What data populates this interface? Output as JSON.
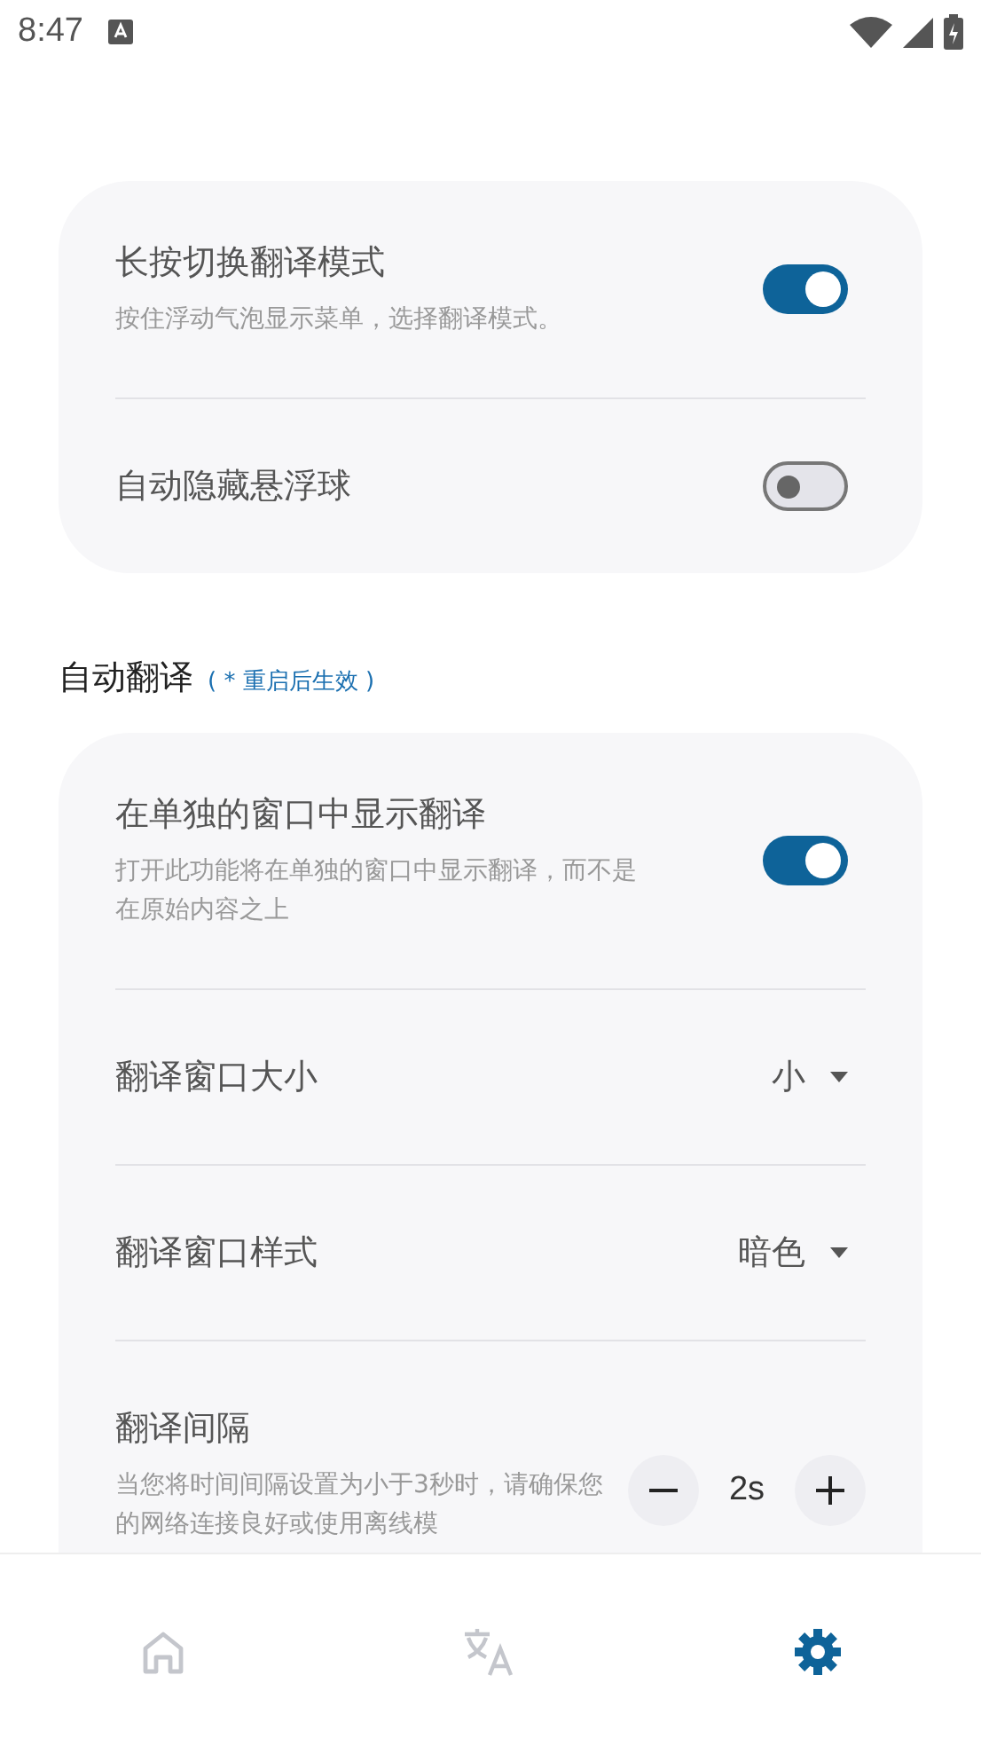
{
  "status_bar": {
    "time": "8:47"
  },
  "general_card": {
    "rows": [
      {
        "kind": "toggle",
        "title": "长按切换翻译模式",
        "description": "按住浮动气泡显示菜单，选择翻译模式。",
        "on": true
      },
      {
        "kind": "toggle",
        "title": "自动隐藏悬浮球",
        "on": false
      }
    ]
  },
  "auto_translate": {
    "title": "自动翻译",
    "note": "( * 重启后生效 )",
    "rows": [
      {
        "kind": "toggle",
        "title": "在单独的窗口中显示翻译",
        "description": "打开此功能将在单独的窗口中显示翻译，而不是在原始内容之上",
        "on": true
      },
      {
        "kind": "dropdown",
        "title": "翻译窗口大小",
        "value": "小"
      },
      {
        "kind": "dropdown",
        "title": "翻译窗口样式",
        "value": "暗色"
      },
      {
        "kind": "stepper",
        "title": "翻译间隔",
        "description": "当您将时间间隔设置为小于3秒时，请确保您的网络连接良好或使用离线模",
        "value": "2s"
      }
    ]
  },
  "bottom_nav": [
    {
      "kind": "home",
      "selected": false
    },
    {
      "kind": "translate",
      "selected": false
    },
    {
      "kind": "settings",
      "selected": true
    }
  ]
}
